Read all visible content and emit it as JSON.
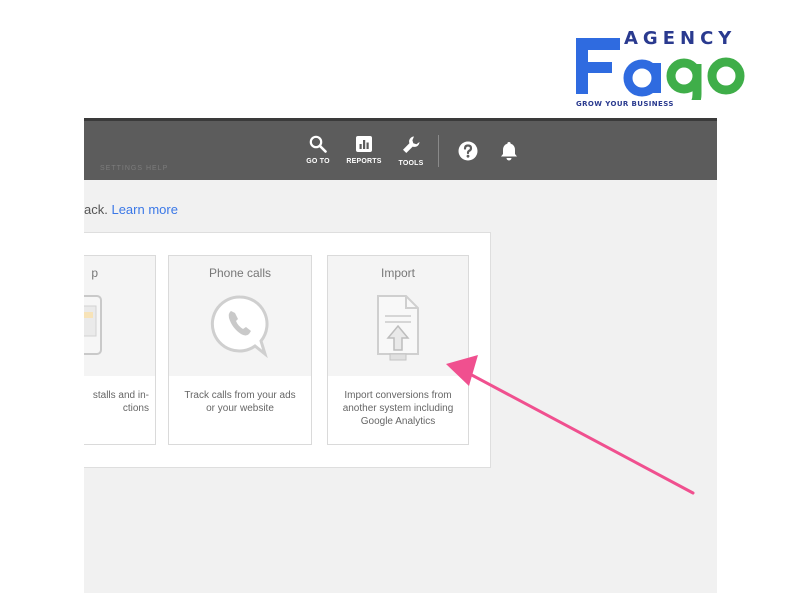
{
  "logo": {
    "word_top": "AGENCY",
    "word_main": "Fago",
    "tagline": "GROW YOUR BUSINESS",
    "colors": {
      "blue": "#2f6be0",
      "green": "#3fae49",
      "navy": "#2a3a8f"
    }
  },
  "topbar": {
    "tools": [
      {
        "label": "GO TO",
        "icon": "search-icon"
      },
      {
        "label": "REPORTS",
        "icon": "reports-icon"
      },
      {
        "label": "TOOLS",
        "icon": "wrench-icon"
      }
    ],
    "help_icon": "help-icon",
    "notifications_icon": "bell-icon",
    "faint_text": "SETTINGS HELP"
  },
  "intro": {
    "prefix": "ack.",
    "link": "Learn more"
  },
  "cards": [
    {
      "title": "p",
      "description": "stalls and in-\nctions",
      "icon": "app-phone-icon"
    },
    {
      "title": "Phone calls",
      "description": "Track calls from your ads\nor your website",
      "icon": "phone-call-icon"
    },
    {
      "title": "Import",
      "description": "Import conversions from\nanother system including\nGoogle Analytics",
      "icon": "import-file-icon"
    }
  ],
  "annotation": {
    "color": "#f0508f",
    "icon": "pink-arrow-icon"
  }
}
